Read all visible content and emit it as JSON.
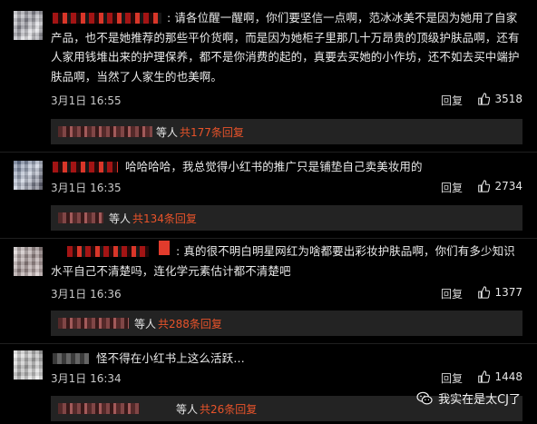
{
  "comments": [
    {
      "text": ": 请各位醒一醒啊，你们要坚信一点啊，范冰冰美不是因为她用了自家产品，也不是她推荐的那些平价货啊，而是因为她柜子里那几十万昂贵的顶级护肤品啊，还有人家用钱堆出来的护理保养，都不是你消费的起的，真要去买她的小作坊，还不如去买中端护肤品啊，当然了人家生的也美啊。",
      "time": "3月1日 16:55",
      "reply_label": "回复",
      "likes": "3518",
      "sub_prefix": "等人",
      "sub_count": "共177条回复"
    },
    {
      "text": "哈哈哈哈，我总觉得小红书的推广只是铺垫自己卖美妆用的",
      "time": "3月1日 16:35",
      "reply_label": "回复",
      "likes": "2734",
      "sub_prefix": "等人",
      "sub_count": "共134条回复"
    },
    {
      "text": ": 真的很不明白明星网红为啥都要出彩妆护肤品啊，你们有多少知识水平自己不清楚吗，连化学元素估计都不清楚吧",
      "time": "3月1日 16:36",
      "reply_label": "回复",
      "likes": "1377",
      "sub_prefix": "等人",
      "sub_count": "共288条回复"
    },
    {
      "text": "怪不得在小红书上这么活跃…",
      "time": "3月1日 16:34",
      "reply_label": "回复",
      "likes": "1448",
      "sub_prefix": "等人",
      "sub_count": "共26条回复"
    }
  ],
  "watermark": "我实在是太CJ了",
  "icons": {
    "like": "thumbs-up-icon",
    "watermark": "wechat-icon"
  },
  "colors": {
    "accent": "#e8532a",
    "background": "#000000"
  }
}
